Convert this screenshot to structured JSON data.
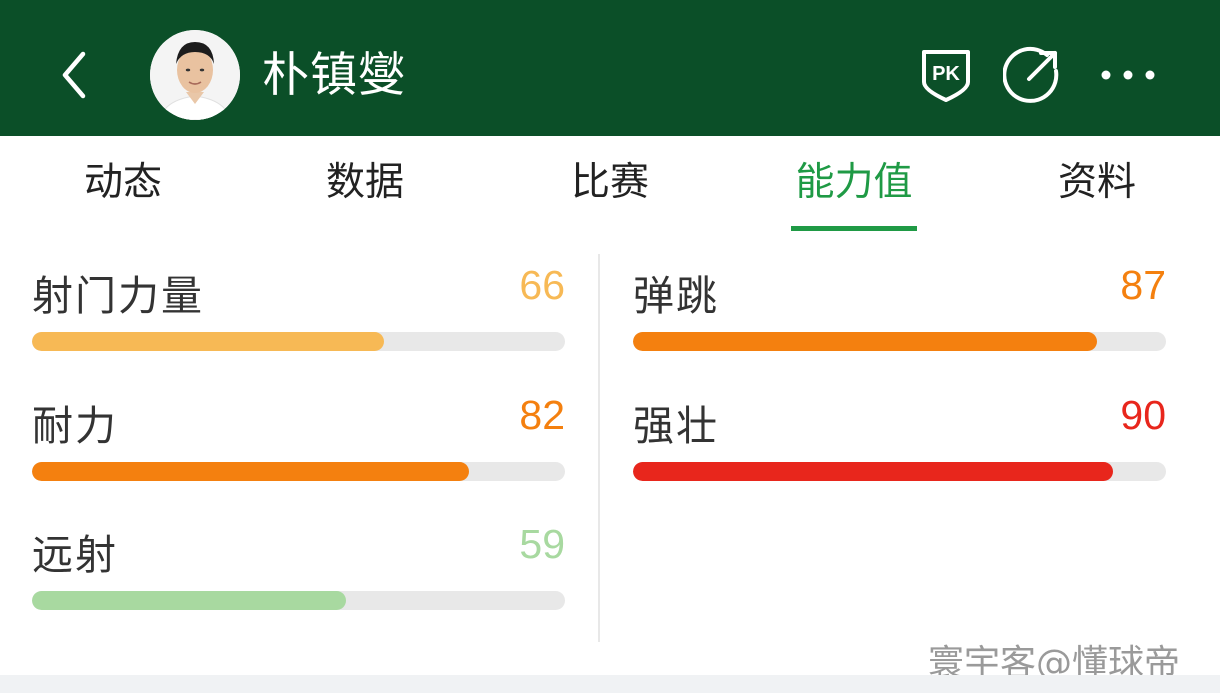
{
  "header": {
    "player_name": "朴镇燮",
    "icons": [
      "back-arrow-icon",
      "pk-shield-icon",
      "share-icon",
      "more-dots-icon"
    ],
    "bg_color": "#0b4f28"
  },
  "tabs": {
    "items": [
      "动态",
      "数据",
      "比赛",
      "能力值",
      "资料"
    ],
    "active": "能力值",
    "active_color": "#1f9a45"
  },
  "stats": {
    "left": [
      {
        "label": "射门力量",
        "value": "66",
        "color": "#f7b955"
      },
      {
        "label": "耐力",
        "value": "82",
        "color": "#f4800f"
      },
      {
        "label": "远射",
        "value": "59",
        "color": "#a8d9a0"
      }
    ],
    "right": [
      {
        "label": "弹跳",
        "value": "87",
        "color": "#f4800f"
      },
      {
        "label": "强壮",
        "value": "90",
        "color": "#e8261c"
      }
    ],
    "max": 100
  },
  "watermark": "寰宇客@懂球帝"
}
